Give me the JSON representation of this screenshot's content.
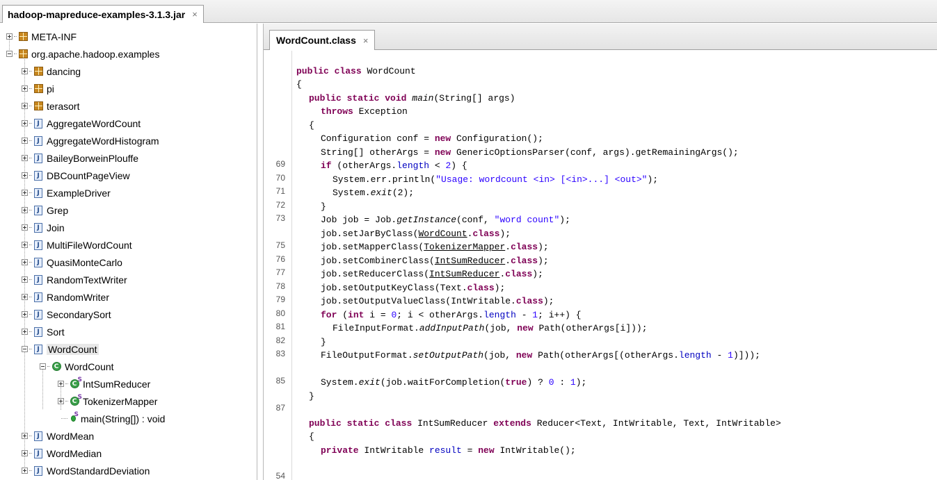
{
  "top_tab": {
    "label": "hadoop-mapreduce-examples-3.1.3.jar",
    "close": "×"
  },
  "editor_tab": {
    "label": "WordCount.class",
    "close": "×"
  },
  "tree": {
    "meta_inf": "META-INF",
    "root_package": "org.apache.hadoop.examples",
    "packages": [
      "dancing",
      "pi",
      "terasort"
    ],
    "classes_before": [
      "AggregateWordCount",
      "AggregateWordHistogram",
      "BaileyBorweinPlouffe",
      "DBCountPageView",
      "ExampleDriver",
      "Grep",
      "Join",
      "MultiFileWordCount",
      "QuasiMonteCarlo",
      "RandomTextWriter",
      "RandomWriter",
      "SecondarySort",
      "Sort"
    ],
    "selected_file": "WordCount",
    "selected_class": "WordCount",
    "inner_classes": [
      "IntSumReducer",
      "TokenizerMapper"
    ],
    "method": "main(String[]) : void",
    "classes_after": [
      "WordMean",
      "WordMedian",
      "WordStandardDeviation"
    ],
    "icon_names": {
      "package": "package-icon",
      "class_file": "java-file-icon",
      "class": "class-icon",
      "static_inner": "static-class-icon",
      "method": "method-icon"
    },
    "colors": {
      "package": "#c8871f",
      "class_file": "#4a6fa8",
      "class": "#3ba04a"
    }
  },
  "code": {
    "line_numbers": {
      "l69": "69",
      "l70": "70",
      "l71": "71",
      "l72": "72",
      "l73": "73",
      "l75": "75",
      "l76": "76",
      "l77": "77",
      "l78": "78",
      "l79": "79",
      "l80": "80",
      "l81": "81",
      "l82": "82",
      "l83": "83",
      "l85": "85",
      "l87": "87",
      "l54": "54"
    },
    "colors": {
      "keyword": "#7f0055",
      "string": "#2a00ff",
      "field": "#0000c0"
    },
    "t": {
      "public": "public",
      "class": "class",
      "static": "static",
      "void": "void",
      "throws": "throws",
      "new": "new",
      "if": "if",
      "for": "for",
      "int": "int",
      "true": "true",
      "private": "private",
      "extends": "extends",
      "dotclass": "class",
      "WordCount": "WordCount",
      "main": "main",
      "mainArgs": "(String[] args)",
      "Exception": "Exception",
      "brace_open": "{",
      "brace_close": "}",
      "conf_decl": "Configuration conf = ",
      "conf_new": "Configuration();",
      "other_decl": "String[] otherArgs = ",
      "other_new": "GenericOptionsParser(conf, args).getRemainingArgs();",
      "if_open": "(otherArgs.",
      "length": "length",
      "if_cmp": " < ",
      "two": "2",
      "if_close": ") {",
      "println": "System.err.println(",
      "usage": "\"Usage: wordcount <in> [<in>...] <out>\"",
      "println_end": ");",
      "sys": "System.",
      "exit": "exit",
      "exit2": "(2);",
      "job_decl": "Job job = Job.",
      "getInstance": "getInstance",
      "gi_args": "(conf, ",
      "word_count": "\"word count\"",
      "close_paren": ");",
      "setJar": "job.setJarByClass(",
      "setMapper": "job.setMapperClass(",
      "TokenizerMapper": "TokenizerMapper",
      "setCombiner": "job.setCombinerClass(",
      "IntSumReducer": "IntSumReducer",
      "setReducer": "job.setReducerClass(",
      "setOutKey": "job.setOutputKeyClass(Text.",
      "setOutVal": "job.setOutputValueClass(IntWritable.",
      "dot": ".",
      "dotclose": ");",
      "for_open": " (",
      "for_init": " i = ",
      "zero": "0",
      "for_mid": "; i < otherArgs.",
      "minus": " - ",
      "one": "1",
      "for_close": "; i++) {",
      "fif": "FileInputFormat.",
      "addInputPath": "addInputPath",
      "fif_args": "(job, ",
      "path_args": " Path(otherArgs[i]));",
      "fof": "FileOutputFormat.",
      "setOutputPath": "setOutputPath",
      "fof_args": "(job, ",
      "fof_path": " Path(otherArgs[(otherArgs.",
      "fof_end": ")]));",
      "wait": "(job.waitForCompletion(",
      "tern": ") ? ",
      "colon": " : ",
      "exit_end": ");",
      "isr_decl": " IntSumReducer ",
      "reducer_gen": " Reducer<Text, IntWritable, Text, IntWritable>",
      "result_decl": " IntWritable ",
      "result": "result",
      "eq": " = ",
      "iw_new": " IntWritable();"
    }
  }
}
